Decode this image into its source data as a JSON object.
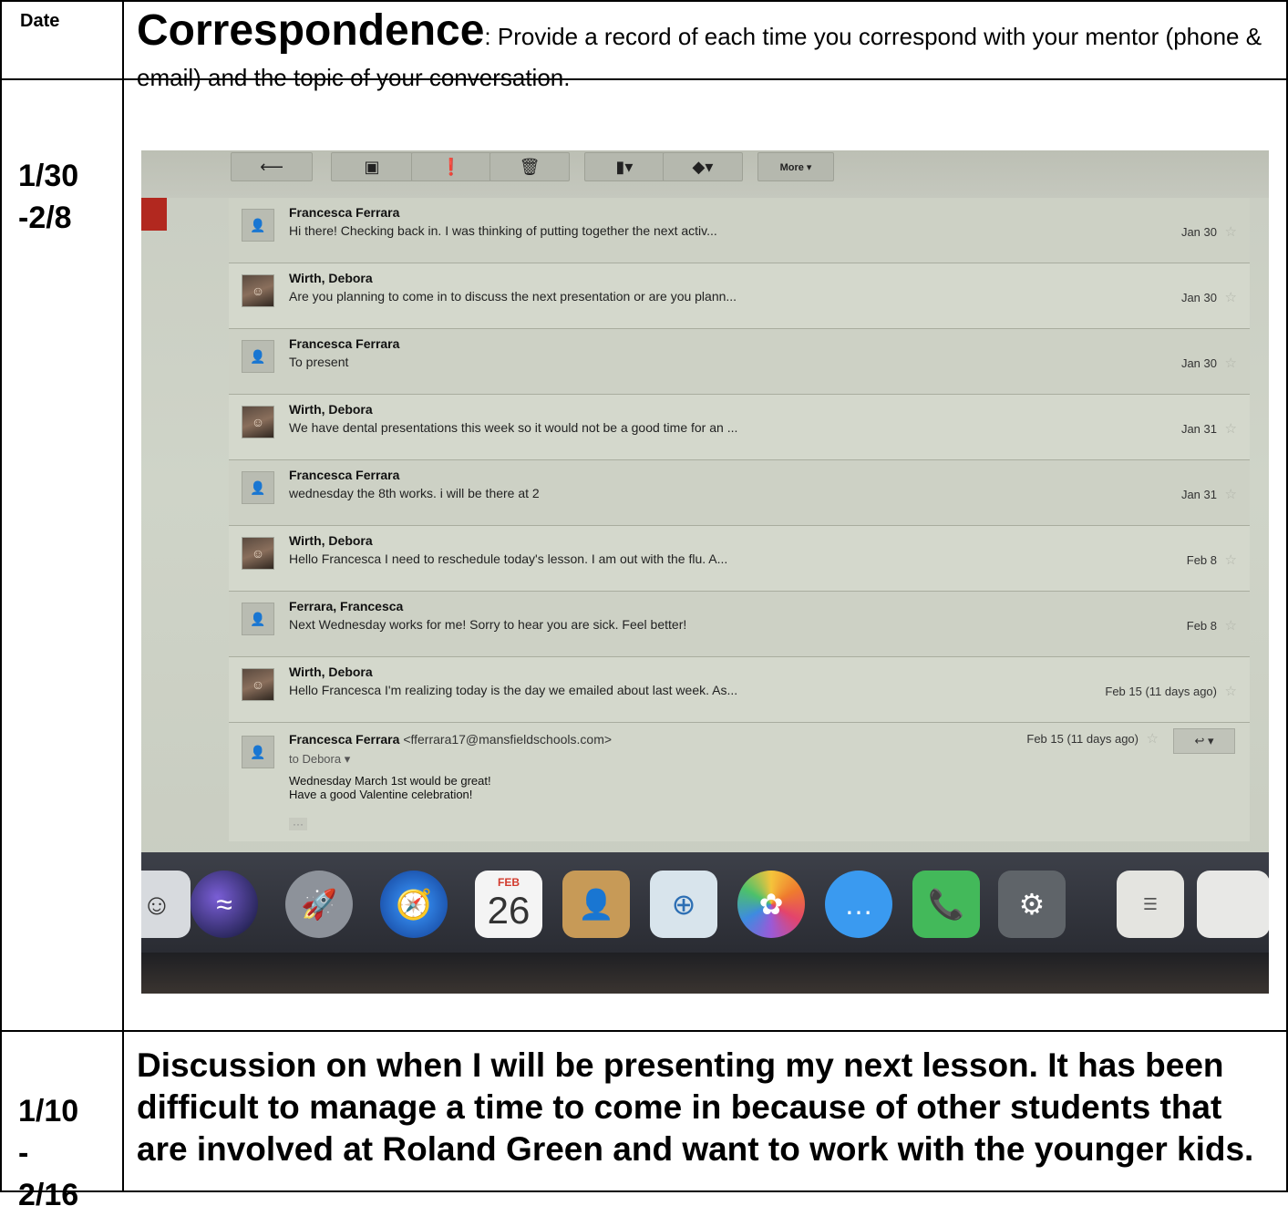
{
  "header": {
    "date_label": "Date",
    "title": "Correspondence",
    "subtitle": ": Provide a record of each time you correspond with your mentor (phone & email) and the topic of your conversation."
  },
  "row1": {
    "date_line1": "1/30",
    "date_line2": "-2/8"
  },
  "screenshot": {
    "toolbar": {
      "back": "⟵",
      "archive": "▣",
      "spam": "❗",
      "delete": "🗑",
      "folder": "▮▾",
      "label": "◆▾",
      "more": "More ▾"
    },
    "messages": [
      {
        "sender": "Francesca Ferrara",
        "snippet": "Hi there! Checking back in. I was thinking of putting together the next activ...",
        "date": "Jan 30",
        "has_photo": false
      },
      {
        "sender": "Wirth, Debora",
        "snippet": "Are you planning to come in to discuss the next presentation or are you plann...",
        "date": "Jan 30",
        "has_photo": true
      },
      {
        "sender": "Francesca Ferrara",
        "snippet": "To present",
        "date": "Jan 30",
        "has_photo": false
      },
      {
        "sender": "Wirth, Debora",
        "snippet": "We have dental presentations this week so it would not be a good time for an ...",
        "date": "Jan 31",
        "has_photo": true
      },
      {
        "sender": "Francesca Ferrara",
        "snippet": "wednesday the 8th works. i will be there at 2",
        "date": "Jan 31",
        "has_photo": false
      },
      {
        "sender": "Wirth, Debora",
        "snippet": "Hello Francesca I need to reschedule today's lesson. I am out with the flu. A...",
        "date": "Feb 8",
        "has_photo": true
      },
      {
        "sender": "Ferrara, Francesca",
        "snippet": "Next Wednesday works for me! Sorry to hear you are sick. Feel better!",
        "date": "Feb 8",
        "has_photo": false
      },
      {
        "sender": "Wirth, Debora",
        "snippet": "Hello Francesca I'm realizing today is the day we emailed about last week. As...",
        "date": "Feb 15 (11 days ago)",
        "has_photo": true
      }
    ],
    "open_message": {
      "sender": "Francesca Ferrara",
      "email": "<fferrara17@mansfieldschools.com>",
      "to": "to Debora ▾",
      "date": "Feb 15 (11 days ago)",
      "body_line1": "Wednesday March 1st would be great!",
      "body_line2": "Have a good Valentine celebration!",
      "ellipsis": "···"
    },
    "dock": {
      "calendar_month": "FEB",
      "calendar_day": "26"
    }
  },
  "row2": {
    "date_line1": "1/10",
    "date_line2": "-",
    "date_line3": "2/16",
    "discussion": "Discussion on when I will be presenting my next lesson. It has been difficult to manage a time to come in because of other students that are involved at Roland Green and want to work with the younger kids."
  }
}
